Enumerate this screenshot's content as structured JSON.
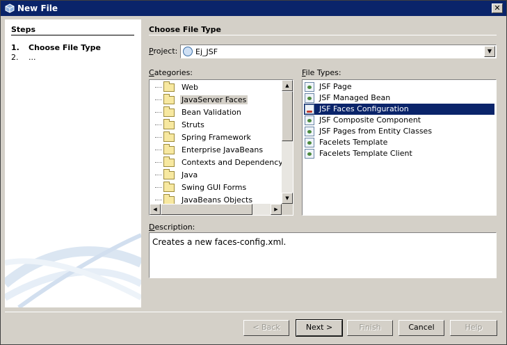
{
  "window": {
    "title": "New File",
    "close_label": "✕"
  },
  "steps": {
    "title": "Steps",
    "items": [
      {
        "num": "1.",
        "label": "Choose File Type"
      },
      {
        "num": "2.",
        "label": "..."
      }
    ]
  },
  "main": {
    "title": "Choose File Type",
    "project": {
      "label_mnemonic": "P",
      "label_rest": "roject:",
      "value": "Ej_JSF"
    },
    "categories": {
      "label_mnemonic": "C",
      "label_rest": "ategories:",
      "selected": "JavaServer Faces",
      "items": [
        "Web",
        "JavaServer Faces",
        "Bean Validation",
        "Struts",
        "Spring Framework",
        "Enterprise JavaBeans",
        "Contexts and Dependency Inj",
        "Java",
        "Swing GUI Forms",
        "JavaBeans Objects"
      ]
    },
    "file_types": {
      "label_mnemonic": "F",
      "label_rest": "ile Types:",
      "selected": "JSF Faces Configuration",
      "items": [
        "JSF Page",
        "JSF Managed Bean",
        "JSF Faces Configuration",
        "JSF Composite Component",
        "JSF Pages from Entity Classes",
        "Facelets Template",
        "Facelets Template Client"
      ]
    },
    "description": {
      "label_mnemonic": "D",
      "label_rest": "escription:",
      "text": "Creates a new faces-config.xml."
    }
  },
  "buttons": {
    "back": "< Back",
    "next": "Next >",
    "finish": "Finish",
    "cancel": "Cancel",
    "help": "Help"
  },
  "colors": {
    "title_bar": "#0a246a",
    "selection": "#0a246a",
    "dialog_bg": "#d4d0c8"
  }
}
